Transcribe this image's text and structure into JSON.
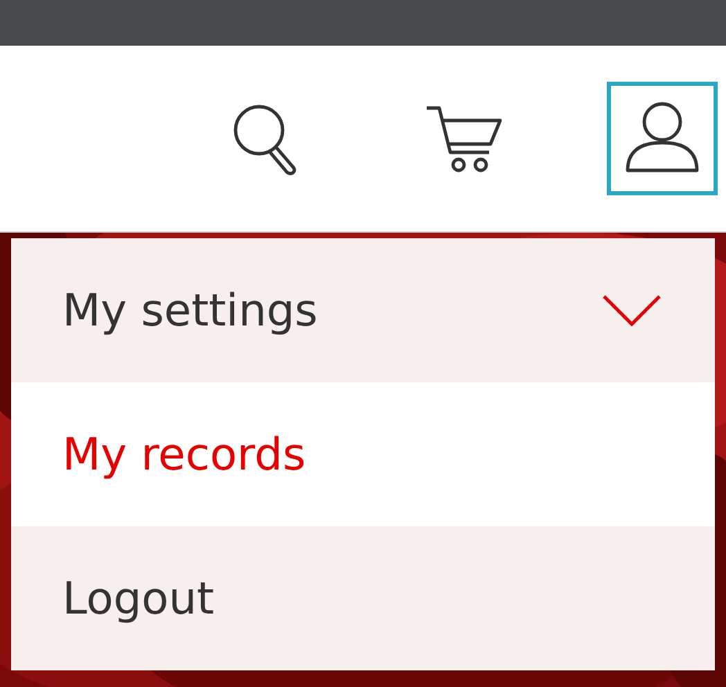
{
  "header_icons": [
    {
      "kind": "search",
      "selected": false
    },
    {
      "kind": "cart",
      "selected": false
    },
    {
      "kind": "account",
      "selected": true
    }
  ],
  "menu": {
    "items": [
      {
        "label": "My settings",
        "kind": "submenu",
        "expanded": false,
        "selected": false
      },
      {
        "label": "My records",
        "kind": "link",
        "selected": true
      },
      {
        "label": "Logout",
        "kind": "link",
        "selected": false
      }
    ]
  }
}
